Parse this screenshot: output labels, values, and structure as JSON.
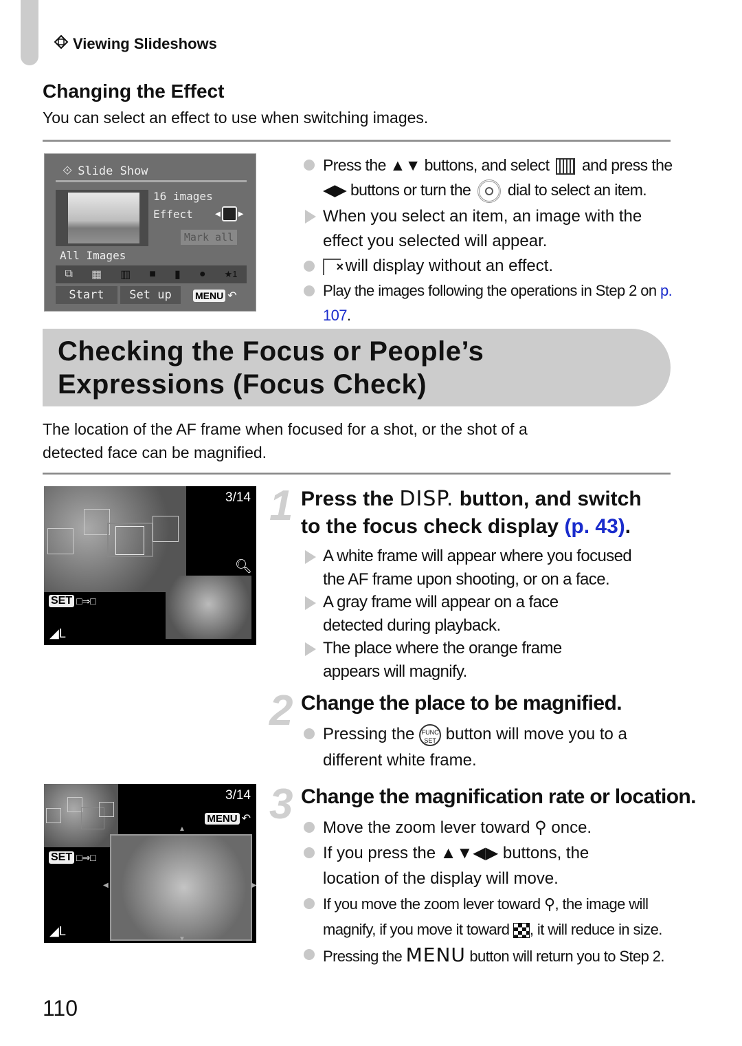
{
  "header": {
    "section_label": "Viewing Slideshows",
    "section_icon": "slideshow-icon"
  },
  "effect_section": {
    "title": "Changing the Effect",
    "intro": "You can select an effect to use when switching images.",
    "camera_screen": {
      "title": "Slide Show",
      "images_count": "16 images",
      "effect_label": "Effect",
      "mark_all": "Mark all",
      "category": "All Images",
      "category_icons": [
        "all-images-icon",
        "date-icon",
        "category-icon",
        "folder-icon",
        "movie-icon",
        "camera-icon",
        "favorites-icon"
      ],
      "favorites_label": "★1",
      "start_button": "Start",
      "setup_button": "Set up",
      "menu_button": "MENU",
      "back_symbol": "↶"
    },
    "bullets": [
      {
        "type": "dot",
        "parts": [
          "Press the ",
          "▲▼",
          " buttons, and select ",
          "[effect-icon]",
          " and press the ",
          "◀▶",
          " buttons or turn the ",
          "[dial-icon]",
          " dial to select an item."
        ]
      },
      {
        "type": "arrow",
        "text": "When you select an item, an image with the effect you selected will appear."
      },
      {
        "type": "dot",
        "text": " will display without an effect."
      },
      {
        "type": "dot",
        "text": "Play the images following the operations in Step 2 on ",
        "link": "p. 107",
        "suffix": "."
      }
    ]
  },
  "focus_section": {
    "title_line1": "Checking the Focus or People’s",
    "title_line2": "Expressions (Focus Check)",
    "intro_line1": "The location of the AF frame when focused for a shot, or the shot of a",
    "intro_line2": "detected face can be magnified.",
    "screen1": {
      "counter": "3/14",
      "set_label": "SET",
      "size_label": "L"
    },
    "screen2": {
      "counter": "3/14",
      "menu_label": "MENU",
      "set_label": "SET",
      "size_label": "L"
    },
    "steps": [
      {
        "number": "1",
        "title_pre": "Press the ",
        "title_disp": "DISP.",
        "title_post": " button, and switch",
        "title_line2": "to the focus check display ",
        "title_link": "(p. 43)",
        "title_end": ".",
        "bullets": [
          {
            "type": "arrow",
            "line1": "A white frame will appear where you focused",
            "line2": "the AF frame upon shooting, or on a face."
          },
          {
            "type": "arrow",
            "line1": "A gray frame will appear on a face",
            "line2": "detected during playback."
          },
          {
            "type": "arrow",
            "line1": "The place where the orange frame",
            "line2": "appears will magnify."
          }
        ]
      },
      {
        "number": "2",
        "title": "Change the place to be magnified.",
        "bullets": [
          {
            "type": "dot",
            "pre": "Pressing the ",
            "icon": "func-set-icon",
            "post": " button will move you to a",
            "line2": "different white frame."
          }
        ]
      },
      {
        "number": "3",
        "title": "Change the magnification rate or location.",
        "bullets": [
          {
            "type": "dot",
            "pre": "Move the zoom lever toward ",
            "icon": "magnify-icon",
            "post": " once."
          },
          {
            "type": "dot",
            "pre": "If you press the ",
            "arrows": "▲▼◀▶",
            "post": " buttons, the",
            "line2": "location of the display will move."
          },
          {
            "type": "dot",
            "pre": "If you move the zoom lever toward ",
            "icon": "magnify-icon",
            "post": ", the image will",
            "line2_pre": "magnify, if you move it toward ",
            "icon2": "index-icon",
            "line2_post": ", it will reduce in size."
          },
          {
            "type": "dot",
            "pre": "Pressing the ",
            "menu": "MENU",
            "post": " button will return you to Step 2."
          }
        ]
      }
    ]
  },
  "footer": {
    "page_number": "110"
  }
}
